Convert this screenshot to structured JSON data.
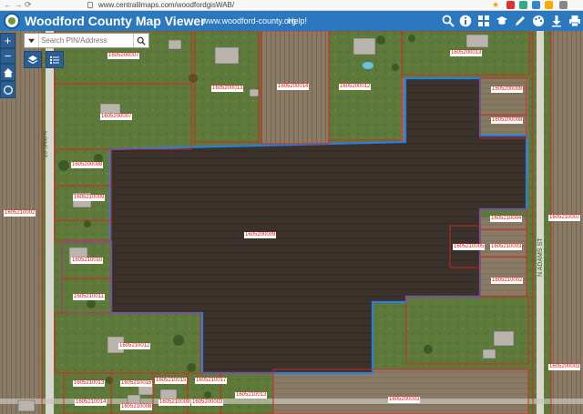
{
  "browser": {
    "nav_glyphs": "← → ⟳",
    "url": "www.centralilmaps.com/woodfordgisWAB/",
    "bookmark_icon": "star-icon"
  },
  "header": {
    "title": "Woodford County Map Viewer",
    "site_link": "www.woodford-county.org",
    "help_link": "Help!",
    "tools": [
      "search-icon",
      "info-icon",
      "grid-icon",
      "graduation-cap-icon",
      "pencil-icon",
      "palette-icon",
      "download-icon",
      "print-icon"
    ]
  },
  "search": {
    "placeholder": "Search PIN/Address"
  },
  "controls": {
    "zoom_in": "+",
    "zoom_out": "−"
  },
  "parcels": [
    "1605200007",
    "1605200013",
    "1605200014",
    "1605200012",
    "1605200013",
    "1605200008",
    "1605200008",
    "1605200007",
    "1605200008",
    "1605210009",
    "1605210002",
    "1605200009",
    "1605210004",
    "1605210007",
    "1605210003",
    "1605210005",
    "1605210002",
    "1605200003",
    "1605210010",
    "1605210011",
    "1605210012",
    "1605210013",
    "1605210016",
    "1605210015",
    "1605210017",
    "1605210013",
    "1605210014",
    "1605210008",
    "1605210009",
    "1605200003",
    "1605200003"
  ],
  "colors": {
    "header": "#2b78bf",
    "parcel_line": "#e02020",
    "selection": "#2a7de1"
  }
}
